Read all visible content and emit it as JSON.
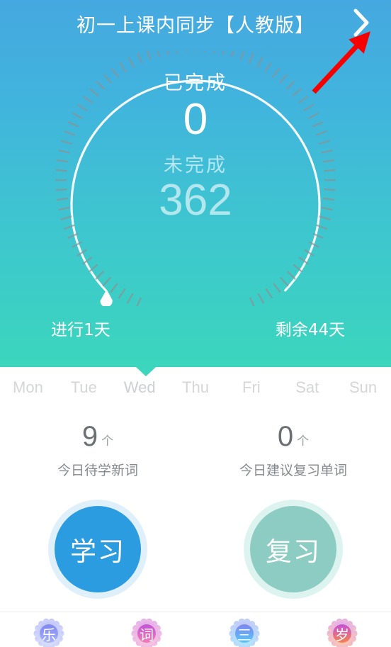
{
  "header": {
    "title": "初一上课内同步【人教版】",
    "chevron_icon": "chevron-right-icon"
  },
  "gauge": {
    "completed_label": "已完成",
    "completed_value": "0",
    "remaining_label": "未完成",
    "remaining_value": "362",
    "progress_marker_icon": "progress-marker-icon",
    "days_elapsed": "进行1天",
    "days_left": "剩余44天",
    "colors": {
      "gradient_top": "#45a8e0",
      "gradient_bottom": "#3bd6bd",
      "arc": "#ffffff",
      "tick": "#8a9396"
    }
  },
  "weekdays": [
    {
      "label": "Mon",
      "active": false
    },
    {
      "label": "Tue",
      "active": false
    },
    {
      "label": "Wed",
      "active": true
    },
    {
      "label": "Thu",
      "active": false
    },
    {
      "label": "Fri",
      "active": false
    },
    {
      "label": "Sat",
      "active": false
    },
    {
      "label": "Sun",
      "active": false
    }
  ],
  "stats": [
    {
      "value": "9",
      "unit": "个",
      "caption": "今日待学新词"
    },
    {
      "value": "0",
      "unit": "个",
      "caption": "今日建议复习单词"
    }
  ],
  "actions": [
    {
      "label": "学习",
      "color": "#2c9ce0",
      "ring": "#dff0fb"
    },
    {
      "label": "复习",
      "color": "#8dccc3",
      "ring": "#ddf3ef"
    }
  ],
  "bottom_bar": [
    {
      "glyph": "乐",
      "icon": "badge-music-icon",
      "c1": "#7f86f0",
      "c2": "#a8b4fb"
    },
    {
      "glyph": "词",
      "icon": "badge-word-icon",
      "c1": "#c451d8",
      "c2": "#f07fb8"
    },
    {
      "glyph": "三",
      "icon": "badge-menu-icon",
      "c1": "#7f86f0",
      "c2": "#56c8f5"
    },
    {
      "glyph": "岁",
      "icon": "badge-age-icon",
      "c1": "#c451d8",
      "c2": "#f6834f"
    }
  ],
  "annotation": {
    "arrow_icon": "red-arrow-annotation-icon",
    "color": "#f70000"
  }
}
